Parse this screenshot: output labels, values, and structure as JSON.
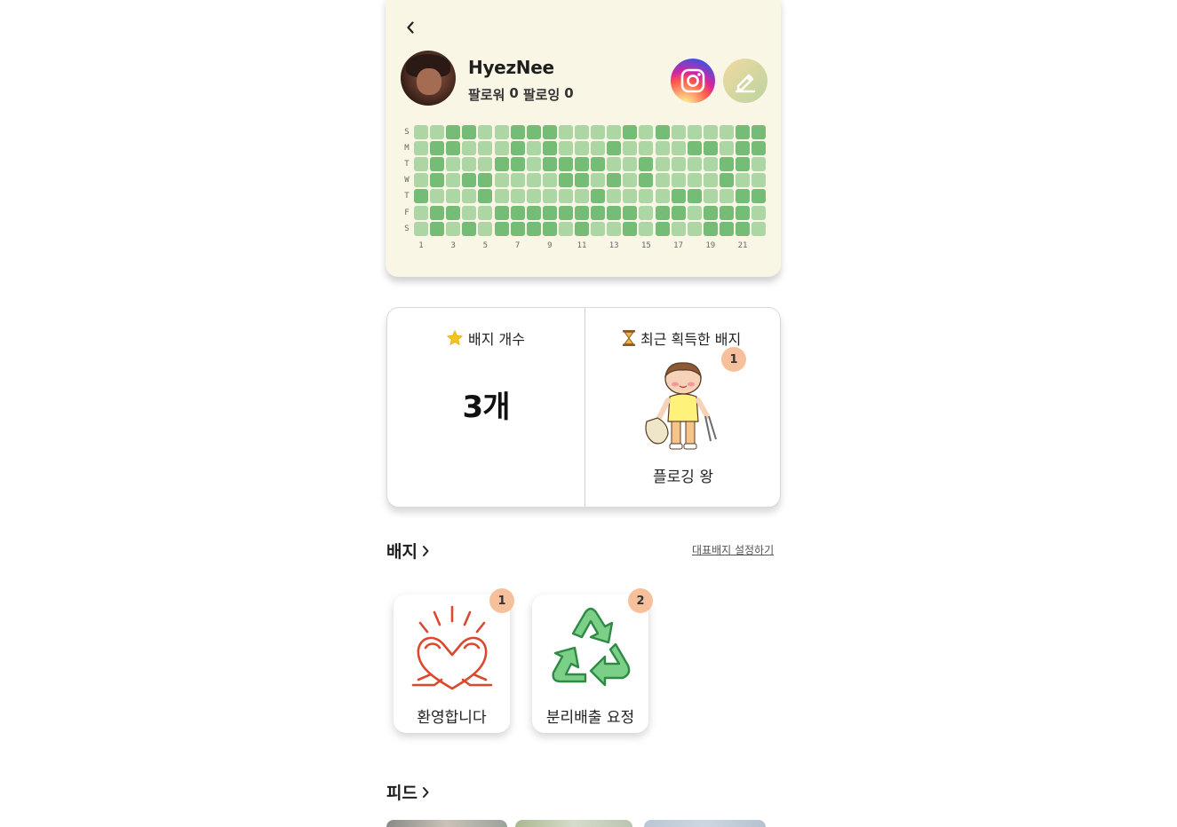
{
  "profile": {
    "username": "HyezNee",
    "followers_label": "팔로워",
    "followers_count": "0",
    "following_label": "팔로잉",
    "following_count": "0",
    "icons": {
      "back": "chevron-left-icon",
      "instagram": "instagram-icon",
      "edit": "pencil-icon"
    }
  },
  "heatmap": {
    "day_labels": [
      "S",
      "M",
      "T",
      "W",
      "T",
      "F",
      "S"
    ],
    "week_labels": [
      "1",
      "3",
      "5",
      "7",
      "9",
      "11",
      "13",
      "15",
      "17",
      "19",
      "21"
    ],
    "colors": {
      "0": "#d6ebcf",
      "1": "#acd7a5",
      "2": "#75bd77"
    },
    "levels": [
      [
        1,
        1,
        2,
        2,
        1,
        1,
        2,
        2,
        2,
        1,
        1,
        1,
        1,
        2,
        1,
        2,
        1,
        1,
        1,
        1,
        2,
        2
      ],
      [
        1,
        2,
        2,
        1,
        1,
        1,
        2,
        1,
        2,
        1,
        1,
        1,
        2,
        1,
        1,
        1,
        1,
        2,
        2,
        1,
        2,
        2
      ],
      [
        1,
        2,
        1,
        1,
        1,
        2,
        2,
        1,
        2,
        2,
        2,
        2,
        1,
        1,
        2,
        1,
        1,
        1,
        1,
        2,
        2,
        1
      ],
      [
        1,
        2,
        1,
        2,
        2,
        1,
        1,
        1,
        1,
        2,
        2,
        1,
        2,
        1,
        2,
        1,
        1,
        1,
        1,
        2,
        1,
        1
      ],
      [
        2,
        1,
        1,
        1,
        2,
        1,
        1,
        1,
        1,
        1,
        1,
        2,
        1,
        1,
        1,
        1,
        2,
        2,
        1,
        1,
        2,
        2
      ],
      [
        1,
        2,
        2,
        1,
        1,
        2,
        2,
        2,
        2,
        2,
        2,
        2,
        2,
        2,
        1,
        2,
        2,
        1,
        2,
        2,
        2,
        1
      ],
      [
        1,
        2,
        1,
        2,
        1,
        2,
        2,
        2,
        2,
        1,
        2,
        1,
        1,
        2,
        1,
        2,
        1,
        1,
        2,
        2,
        2,
        1
      ]
    ]
  },
  "summary": {
    "badge_count_title": "배지 개수",
    "badge_count_value": "3개",
    "recent_badge_title": "최근 획득한 배지",
    "recent_badge_name": "플로깅 왕",
    "recent_badge_count": "1",
    "icons": {
      "count": "star-icon",
      "recent": "hourglass-icon",
      "recent_art": "plogging-boy-icon"
    }
  },
  "badges_section": {
    "title": "배지",
    "set_representative": "대표배지 설정하기",
    "items": [
      {
        "label": "환영합니다",
        "count": "1",
        "icon": "heart-hands-icon"
      },
      {
        "label": "분리배출 요정",
        "count": "2",
        "icon": "recycle-icon"
      }
    ]
  },
  "feed_section": {
    "title": "피드"
  }
}
